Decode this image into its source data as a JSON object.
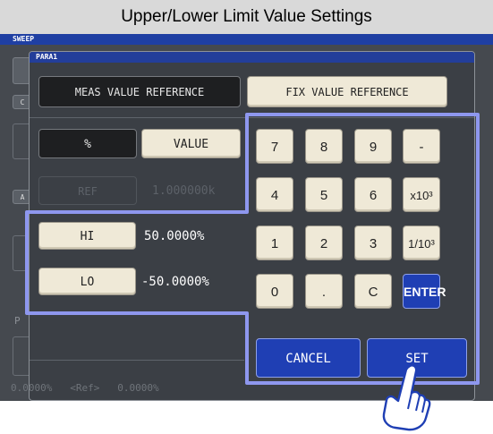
{
  "caption": "Upper/Lower Limit Value Settings",
  "screen": {
    "sweep_label": "SWEEP",
    "background_letters": [
      "C",
      "A"
    ],
    "background_values": "0.0000%   <Ref>   0.0000%",
    "background_p": "P"
  },
  "dialog": {
    "title": "PARA1",
    "tabs": {
      "meas_label": "MEAS VALUE REFERENCE",
      "fix_label": "FIX VALUE REFERENCE"
    },
    "mode": {
      "percent_label": "%",
      "value_label": "VALUE"
    },
    "ref": {
      "label": "REF",
      "value": "1.000000k"
    },
    "limits": {
      "hi_label": "HI",
      "hi_value": "50.0000%",
      "lo_label": "LO",
      "lo_value": "-50.0000%"
    },
    "keypad": {
      "keys": [
        "7",
        "8",
        "9",
        "-",
        "4",
        "5",
        "6",
        "x10³",
        "1",
        "2",
        "3",
        "1/10³",
        "0",
        ".",
        "C",
        "ENTER"
      ]
    },
    "actions": {
      "cancel_label": "CANCEL",
      "set_label": "SET"
    }
  },
  "colors": {
    "accent_blue": "#1f3fb4",
    "highlight": "#8e97ee",
    "key_face": "#efe9d7"
  }
}
